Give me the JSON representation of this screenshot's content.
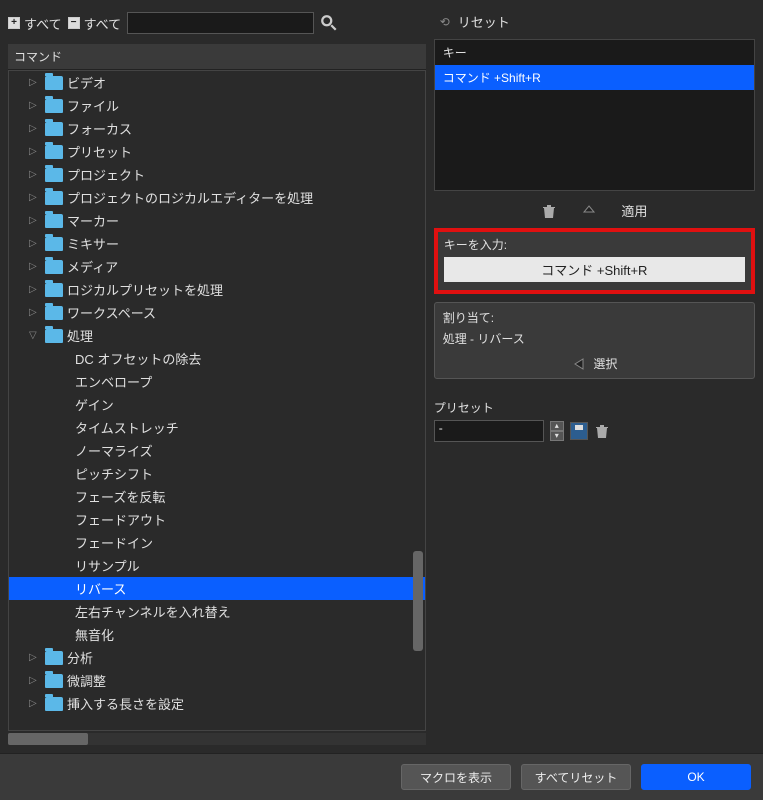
{
  "toolbar": {
    "expand_all": "すべて",
    "collapse_all": "すべて",
    "search_value": ""
  },
  "left": {
    "header": "コマンド",
    "folders": [
      "ビデオ",
      "ファイル",
      "フォーカス",
      "プリセット",
      "プロジェクト",
      "プロジェクトのロジカルエディターを処理",
      "マーカー",
      "ミキサー",
      "メディア",
      "ロジカルプリセットを処理",
      "ワークスペース"
    ],
    "process_folder": "処理",
    "process_items": [
      "DC オフセットの除去",
      "エンベロープ",
      "ゲイン",
      "タイムストレッチ",
      "ノーマライズ",
      "ピッチシフト",
      "フェーズを反転",
      "フェードアウト",
      "フェードイン",
      "リサンプル",
      "リバース",
      "左右チャンネルを入れ替え",
      "無音化"
    ],
    "tail_folders": [
      "分析",
      "微調整",
      "挿入する長さを設定"
    ],
    "selected": "リバース"
  },
  "right": {
    "reset_label": "リセット",
    "keys_header": "キー",
    "key_items": [
      "コマンド +Shift+R"
    ],
    "apply_label": "適用",
    "keyinput_label": "キーを入力:",
    "keyinput_value": "コマンド +Shift+R",
    "assignment_label": "割り当て:",
    "assignment_value": "処理 - リバース",
    "select_label": "選択",
    "preset_label": "プリセット",
    "preset_value": "-"
  },
  "footer": {
    "macro": "マクロを表示",
    "reset_all": "すべてリセット",
    "ok": "OK"
  }
}
